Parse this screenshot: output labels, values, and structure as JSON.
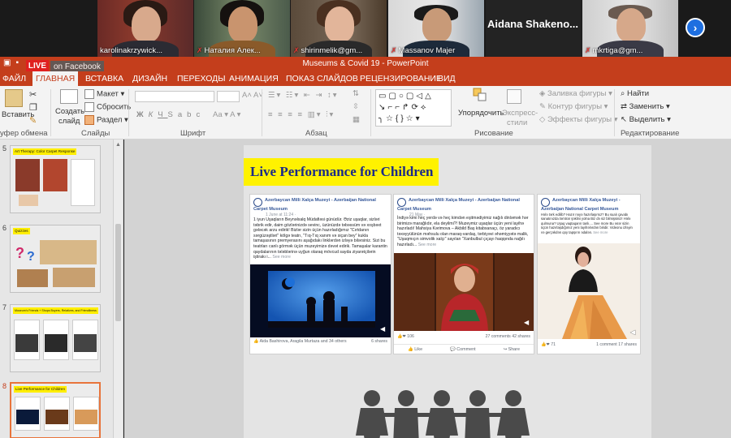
{
  "participants": [
    {
      "name": "karolinakrzywick..."
    },
    {
      "name": "Наталия Алек..."
    },
    {
      "name": "shirinmelik@gm..."
    },
    {
      "name": "Massanov Majer"
    },
    {
      "name": "mkrtiga@gm..."
    }
  ],
  "name_only_tile": {
    "big_name": "Aidana Shakeno...",
    "name": ""
  },
  "live_badge": {
    "live": "LIVE",
    "platform": "on Facebook"
  },
  "titlebar": {
    "title": "Museums & Covid 19 - PowerPoint"
  },
  "tabs": [
    {
      "label": "ФАЙЛ"
    },
    {
      "label": "ГЛАВНАЯ"
    },
    {
      "label": "ВСТАВКА"
    },
    {
      "label": "ДИЗАЙН"
    },
    {
      "label": "ПЕРЕХОДЫ"
    },
    {
      "label": "АНИМАЦИЯ"
    },
    {
      "label": "ПОКАЗ СЛАЙДОВ"
    },
    {
      "label": "РЕЦЕНЗИРОВАНИЕ"
    },
    {
      "label": "ВИД"
    }
  ],
  "ribbon": {
    "paste": "Вставить",
    "clipboard_group": "уфер обмена",
    "new_slide": "Создать",
    "new_slide2": "слайд",
    "layout": "Макет",
    "reset": "Сбросить",
    "section": "Раздел",
    "slides_group": "Слайды",
    "font_group": "Шрифт",
    "font_bold": "Ж",
    "font_italic": "К",
    "font_underline": "Ч",
    "font_strike": "S",
    "font_spacing": "abc",
    "paragraph_group": "Абзац",
    "arrange": "Упорядочить",
    "quick_styles": "Экспресс-",
    "quick_styles2": "стили",
    "shape_fill": "Заливка фигуры",
    "shape_outline": "Контур фигуры",
    "shape_effects": "Эффекты фигуры",
    "drawing_group": "Рисование",
    "find": "Найти",
    "replace": "Заменить",
    "select": "Выделить",
    "editing_group": "Редактирование"
  },
  "thumbnails": [
    {
      "num": "5",
      "title": "Art Therapy: Color Carpet Response"
    },
    {
      "num": "6",
      "title": "Quizzes"
    },
    {
      "num": "7",
      "title": "Museum's Friends + Shops Buyers, Relatives, and Friendliness"
    },
    {
      "num": "8",
      "title": "Live Performance for Children"
    }
  ],
  "slide": {
    "title": "Live Performance for Children",
    "posts": [
      {
        "page": "Azerbaycan Milli Xalça Muzeyi - Azerbaijan National Carpet Museum",
        "date": "1 June at 11:24 · ",
        "text": "1 iyun Uşaqların Beynəlxalq Müdafiəsi günüdür. Əziz uşaqlar, sizləri təbrik edir, daim gözlərinizdə sevinc, üzünüzdə təbəssüm və xoşbəxt gələcək arzu edirik! Bizlər sizin üçün hazırladığımız \"Cırtdanın sərgüzəştləri\" kölgə teatrı, \"Tıq-Tıq xanım və siçan bey\" kukla tamaşasının premyerasını aşağıdakı linklərdən izləyə bilərsiniz. Sizi bu teatrları canlı görmək üçün muzeyimizə dəvət edirik. Tamaşalar karantin qaydalarının tələblərinə uyğun olaraq mövcud sayda ziyarətçilərin iştirakı i...",
        "more": "See more",
        "reactions": "Aida Bashirova, Aragila Murtaza and 34 others",
        "shares": "6 shares"
      },
      {
        "page": "Azerbaycan Milli Xalça Muzeyi - Azerbaijan National Carpet Museum",
        "date": "21 May · ",
        "text": "İndiyə kimi heç yerdə və heç kimdən eşitmədiyimiz nağılı dinləmək hər birimizə marağlıdır, ela deyilmi?! Muzeymiz uşaqlar üçün yeni layihə hazırladı! Mahsiya Kərimova – Akbild Baş kitabxanaçı, öz yaradıcı təxəyyülünün məhsulu olan maraq-vardaş, tərbiyəvi əhəmiyyətə malik, \"Uşaqmıçın simvolik xalçı\" sayılan \"Xanbulbul çıçayı haqqında nağılı hazırladı...",
        "more": "See more",
        "likes": "106",
        "comments": "27 comments",
        "shares": "42 shares",
        "like": "Like",
        "comment": "Comment",
        "share": "Share"
      },
      {
        "page": "Azerbaycan Milli Xalça Muzeyi - Azerbaijan National Carpet Museum",
        "date": "",
        "text": "Hələ tərk edilib? Hazır nəyə hazırlaşırsız? Bu sualı çavabı sanatınızda təmtrar şəklini yolna Biz də siz bilmişsiniz! Hələ qulmuna? Uşaq vaqtaqarın tanlı.... See more Bu əsər sizin üçün hazırlaşdığımız yeni layihələrdən biridir. Videonu izləyin və gerçəkdən qoy tapşırın ədalən.",
        "more": "See more",
        "text2": "Bir çox hələ hayat təsdiqlə bərabər uyğunlaşın istəyələrdən: yeni əl tamamilə kompozisiya, yarandıqca ana yeni səhifəmizə əlavə olunacaq.",
        "more2": "See Translation",
        "likes": "71",
        "comments": "1 comment",
        "shares": "17 shares"
      }
    ]
  }
}
